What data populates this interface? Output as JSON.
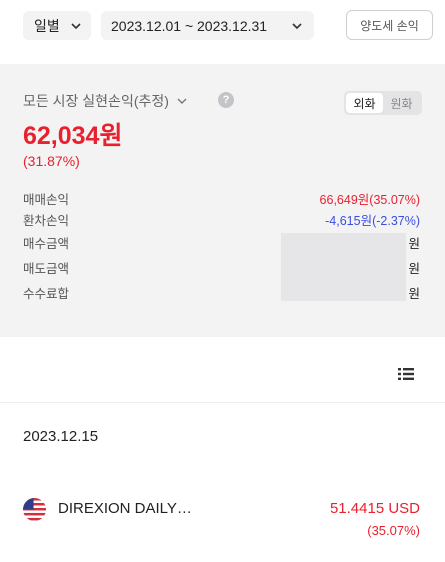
{
  "filters": {
    "period_label": "일별",
    "date_range": "2023.12.01 ~ 2023.12.31",
    "tax_button_label": "양도세 손익"
  },
  "summary": {
    "market_label": "모든 시장 실현손익(추정)",
    "help_icon": "?",
    "currency_options": [
      "외화",
      "원화"
    ],
    "total_amount": "62,034원",
    "total_rate": "(31.87%)",
    "rows": [
      {
        "label": "매매손익",
        "value": "66,649원(35.07%)"
      },
      {
        "label": "환차손익",
        "value": "-4,615원(-2.37%)"
      },
      {
        "label": "매수금액",
        "value": "원"
      },
      {
        "label": "매도금액",
        "value": "원"
      },
      {
        "label": "수수료합",
        "value": "원"
      }
    ]
  },
  "list": {
    "date": "2023.12.15",
    "items": [
      {
        "name": "DIREXION DAILY…",
        "amount": "51.4415 USD",
        "rate": "(35.07%)",
        "flag_icon": "us-flag-icon"
      }
    ]
  },
  "colors": {
    "profit": "#e8212f",
    "loss": "#3b4ee0",
    "panel_bg": "#f3f3f4"
  }
}
